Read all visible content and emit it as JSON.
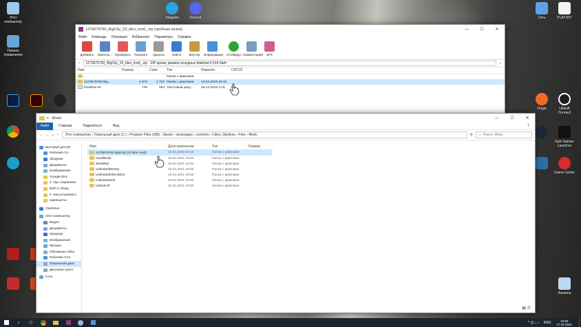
{
  "desktop_icons": [
    {
      "label": "Этот компьютер",
      "color": "#9fc7ee"
    },
    {
      "label": "Панель управления",
      "color": "#6aa3d8"
    },
    {
      "label": "Telegram",
      "color": "#2aa3df"
    },
    {
      "label": "Discord",
      "color": "#5865f2"
    },
    {
      "label": "Сеть",
      "color": "#5fa1e6"
    },
    {
      "label": "PLAY.007",
      "color": "#f3f3f3"
    },
    {
      "label": "Origin",
      "color": "#f36b21"
    },
    {
      "label": "Ubisoft Connect",
      "color": "#1d1d1d"
    },
    {
      "label": "Epic Games Launcher",
      "color": "#111111"
    },
    {
      "label": "Game Center",
      "color": "#d82b2b"
    },
    {
      "label": "Корзина",
      "color": "#bcd8f2"
    }
  ],
  "winrar": {
    "title": "1270675750_BigCity_23_tiles_mod_.zip (пробная копия)",
    "menu": [
      "Файл",
      "Команды",
      "Операции",
      "Избранное",
      "Параметры",
      "Справка"
    ],
    "tools": [
      {
        "label": "Добавить",
        "color": "#d94b3d"
      },
      {
        "label": "Извлечь...",
        "color": "#5b84c4"
      },
      {
        "label": "Проверить",
        "color": "#e05a5a"
      },
      {
        "label": "Показать",
        "color": "#6b9fd1"
      },
      {
        "label": "Удалить",
        "color": "#9a9a9a"
      },
      {
        "label": "Найти",
        "color": "#3b7ad1"
      },
      {
        "label": "Мастер",
        "color": "#c89b3a"
      },
      {
        "label": "Информация",
        "color": "#4d8fd6"
      },
      {
        "label": "Антивирус",
        "color": "#2fa33a"
      },
      {
        "label": "Комментарий",
        "color": "#7c9cc2"
      },
      {
        "label": "SFX",
        "color": "#d35d8b"
      }
    ],
    "path": "1270675750_BigCity_23_tiles_mod_.zip - ZIP архив, размер исходных файлов 5 619 байт",
    "columns": [
      "Имя",
      "Размер",
      "Сжат",
      "Тип",
      "Изменён",
      "CRC32"
    ],
    "rows": [
      {
        "name": "..",
        "size": "",
        "packed": "",
        "type": "Папка с файлами",
        "modified": "",
        "crc": ""
      },
      {
        "name": "1270675750 Big...",
        "size": "4 874",
        "packed": "1 702",
        "type": "Папка с файлами",
        "modified": "13.02.2018 19:10",
        "crc": ""
      },
      {
        "name": "Readme.txt",
        "size": "745",
        "packed": "284",
        "type": "Текстовый доку...",
        "modified": "29.12.2018 4:16",
        "crc": "BA"
      }
    ]
  },
  "explorer": {
    "title": "Mods",
    "tabs": [
      "Файл",
      "Главная",
      "Поделиться",
      "Вид"
    ],
    "breadcrumb": "Этот компьютер  ›  Локальный диск (C:)  ›  Program Files (x86)  ›  Steam  ›  steamapps  ›  common  ›  Cities_Skylines  ›  Files  ›  Mods",
    "search_placeholder": "Поиск: Mods",
    "nav": [
      {
        "label": "Быстрый доступ",
        "color": "#4a90e2"
      },
      {
        "label": "Рабочий сто",
        "color": "#4a90e2"
      },
      {
        "label": "Загрузки",
        "color": "#2f7bd1"
      },
      {
        "label": "Документы",
        "color": "#8aa4c8"
      },
      {
        "label": "Изображения",
        "color": "#7ab0e0"
      },
      {
        "label": "Google Disc",
        "color": "#f2c14a"
      },
      {
        "label": "2. Где сохранени",
        "color": "#e8c05a"
      },
      {
        "label": "Nioh 2 обзор",
        "color": "#e8c05a"
      },
      {
        "label": "2. Как установить",
        "color": "#e8c05a"
      },
      {
        "label": "скриншоты",
        "color": "#e8c05a"
      },
      {
        "label": "OneDrive",
        "color": "#2f7bd1"
      },
      {
        "label": "Этот компьютер",
        "color": "#6aa3d8"
      },
      {
        "label": "Видео",
        "color": "#6b86a8"
      },
      {
        "label": "Документы",
        "color": "#8aa4c8"
      },
      {
        "label": "Загрузки",
        "color": "#2f7bd1"
      },
      {
        "label": "Изображения",
        "color": "#7ab0e0"
      },
      {
        "label": "Музыка",
        "color": "#6aa3d8"
      },
      {
        "label": "Объемные объе",
        "color": "#7ab0e0"
      },
      {
        "label": "Рабочий стол",
        "color": "#4a90e2"
      },
      {
        "label": "Локальный диск",
        "color": "#9aa5b1"
      },
      {
        "label": "Дисковое прост",
        "color": "#9aa5b1"
      },
      {
        "label": "Сеть",
        "color": "#6aa3d8"
      }
    ],
    "columns": [
      "Имя",
      "Дата изменения",
      "Тип",
      "Размер"
    ],
    "rows": [
      {
        "name": "1270675750 BigCity (23 tiles mod)",
        "date": "13.02.2018 19:10",
        "type": "Папка с файлами",
        "selected": true
      },
      {
        "name": "HardMode",
        "date": "16.02.2021 19:52",
        "type": "Папка с файлами",
        "selected": false
      },
      {
        "name": "NewMod",
        "date": "16.02.2021 19:52",
        "type": "Папка с файлами",
        "selected": false
      },
      {
        "name": "UnlimitedMoney",
        "date": "16.02.2021 19:52",
        "type": "Папка с файлами",
        "selected": false
      },
      {
        "name": "UnlimitedOilAndOre",
        "date": "16.02.2021 19:52",
        "type": "Папка с файлами",
        "selected": false
      },
      {
        "name": "UnlimitedSoil",
        "date": "16.02.2021 19:52",
        "type": "Папка с файлами",
        "selected": false
      },
      {
        "name": "UnlockAll",
        "date": "16.02.2021 19:52",
        "type": "Папка с файлами",
        "selected": false
      }
    ]
  },
  "taskbar": {
    "lang": "ENG",
    "time": "19:50",
    "date": "17.02.2021"
  }
}
